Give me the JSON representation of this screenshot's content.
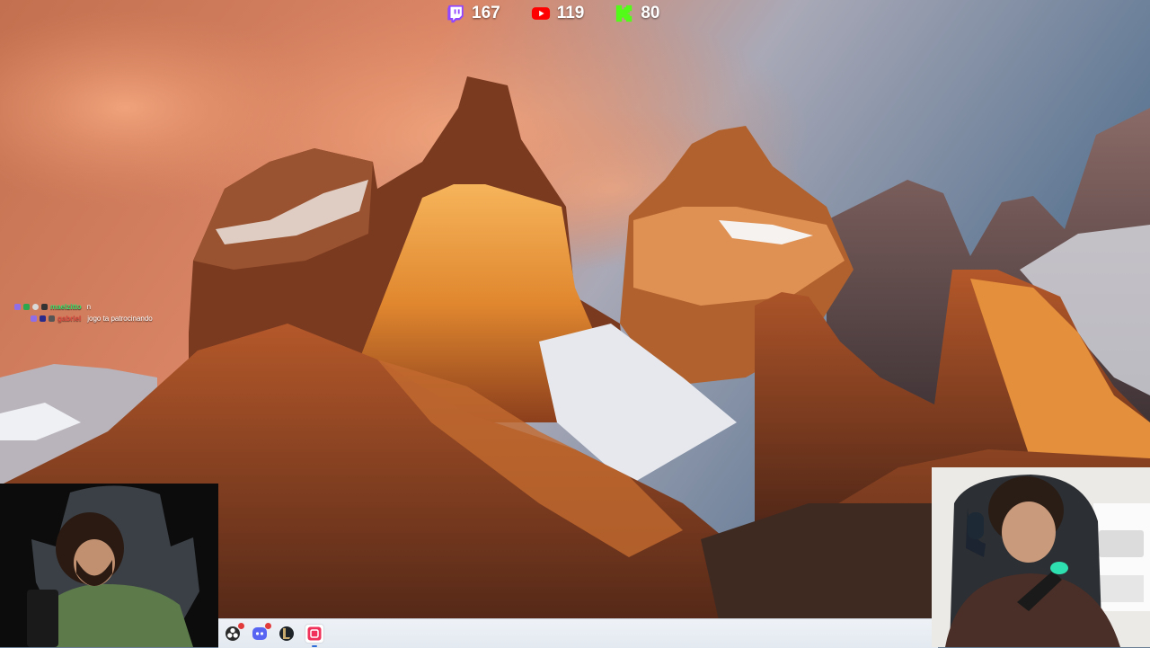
{
  "viewer_counts": [
    {
      "platform": "twitch",
      "icon": "twitch-icon",
      "count": "167",
      "color": "#9146ff"
    },
    {
      "platform": "youtube",
      "icon": "youtube-icon",
      "count": "119",
      "color": "#ff0000"
    },
    {
      "platform": "kick",
      "icon": "kick-icon",
      "count": "80",
      "color": "#53fc18"
    }
  ],
  "chat": [
    {
      "username": "maelzitto",
      "message": "n",
      "username_color": "#39e06b"
    },
    {
      "username": "gabriel",
      "message": "jogo ta patrocinando",
      "username_color": "#e0413a"
    }
  ],
  "taskbar": {
    "apps": [
      {
        "name": "obs-app-icon",
        "label": "OBS"
      },
      {
        "name": "discord-app-icon",
        "label": "Discord",
        "badge": "9"
      },
      {
        "name": "league-app-icon",
        "label": "League of Legends"
      },
      {
        "name": "streaming-app-icon",
        "label": "Streaming app",
        "active": true
      }
    ]
  }
}
